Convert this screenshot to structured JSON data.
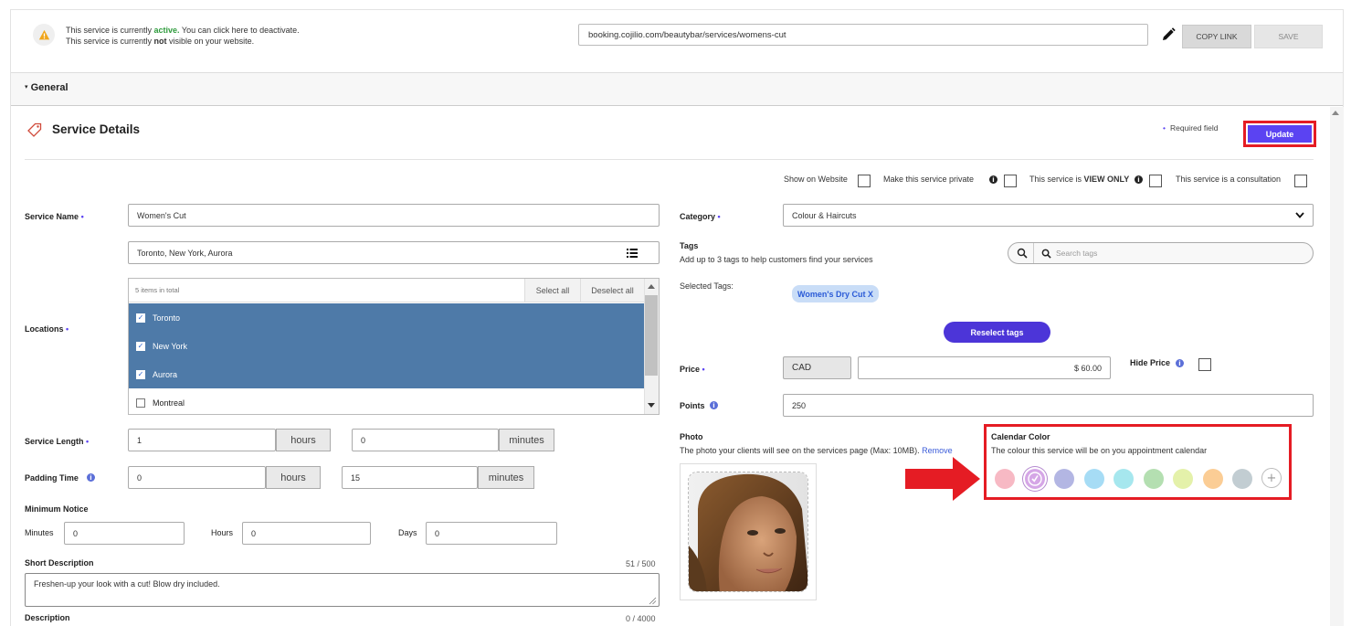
{
  "topbar": {
    "status_line1_pre": "This service is currently ",
    "status_line1_active": "active.",
    "status_line1_post": " You can click here to deactivate.",
    "status_line2_pre": "This service is currently ",
    "status_line2_not": "not",
    "status_line2_post": " visible on your website.",
    "url": "booking.cojilio.com/beautybar/services/womens-cut",
    "copy_link_label": "COPY LINK",
    "save_label": "SAVE"
  },
  "general": {
    "label": "General"
  },
  "service_details": {
    "title": "Service Details",
    "required_field": "Required field",
    "update_label": "Update"
  },
  "checkboxes": {
    "show_on_website": "Show on Website",
    "make_private": "Make this service private",
    "view_only_pre": "This service is ",
    "view_only_bold": "VIEW ONLY",
    "consultation": "This service is a consultation"
  },
  "service_name": {
    "label": "Service Name",
    "value": "Women's Cut"
  },
  "locations": {
    "label": "Locations",
    "summary": "Toronto, New York, Aurora",
    "count": "5 items in total",
    "select_all": "Select all",
    "deselect_all": "Deselect all",
    "items": [
      {
        "name": "Toronto",
        "selected": true
      },
      {
        "name": "New York",
        "selected": true
      },
      {
        "name": "Aurora",
        "selected": true
      },
      {
        "name": "Montreal",
        "selected": false
      }
    ]
  },
  "service_length": {
    "label": "Service Length",
    "hours": "1",
    "hours_unit": "hours",
    "minutes": "0",
    "minutes_unit": "minutes"
  },
  "padding_time": {
    "label": "Padding Time",
    "hours": "0",
    "hours_unit": "hours",
    "minutes": "15",
    "minutes_unit": "minutes"
  },
  "minimum_notice": {
    "label": "Minimum Notice",
    "minutes_label": "Minutes",
    "minutes": "0",
    "hours_label": "Hours",
    "hours": "0",
    "days_label": "Days",
    "days": "0"
  },
  "short_description": {
    "label": "Short Description",
    "counter": "51 / 500",
    "value": "Freshen-up your look with a cut! Blow dry included."
  },
  "description": {
    "label": "Description",
    "counter": "0 / 4000"
  },
  "category": {
    "label": "Category",
    "value": "Colour & Haircuts"
  },
  "tags": {
    "label": "Tags",
    "hint": "Add up to 3 tags to help customers find your services",
    "search_placeholder": "Search tags",
    "selected_label": "Selected Tags:",
    "selected": [
      "Women's Dry Cut X"
    ],
    "reselect_label": "Reselect tags"
  },
  "price": {
    "label": "Price",
    "currency": "CAD",
    "value": "$ 60.00",
    "hide_label": "Hide Price"
  },
  "points": {
    "label": "Points",
    "value": "250"
  },
  "photo": {
    "label": "Photo",
    "hint": "The photo your clients will see on the services page (Max: 10MB).",
    "remove_label": "Remove"
  },
  "calendar_color": {
    "label": "Calendar Color",
    "hint": "The colour this service will be on you appointment calendar",
    "swatches": [
      "#f7b9c4",
      "#d5a6e6",
      "#b3b6e3",
      "#a6dcf5",
      "#a6e7ee",
      "#b4dfb1",
      "#e4f1aa",
      "#fbcd95",
      "#c2cdd2"
    ],
    "selected_index": 1,
    "accent": "#e51c24"
  }
}
